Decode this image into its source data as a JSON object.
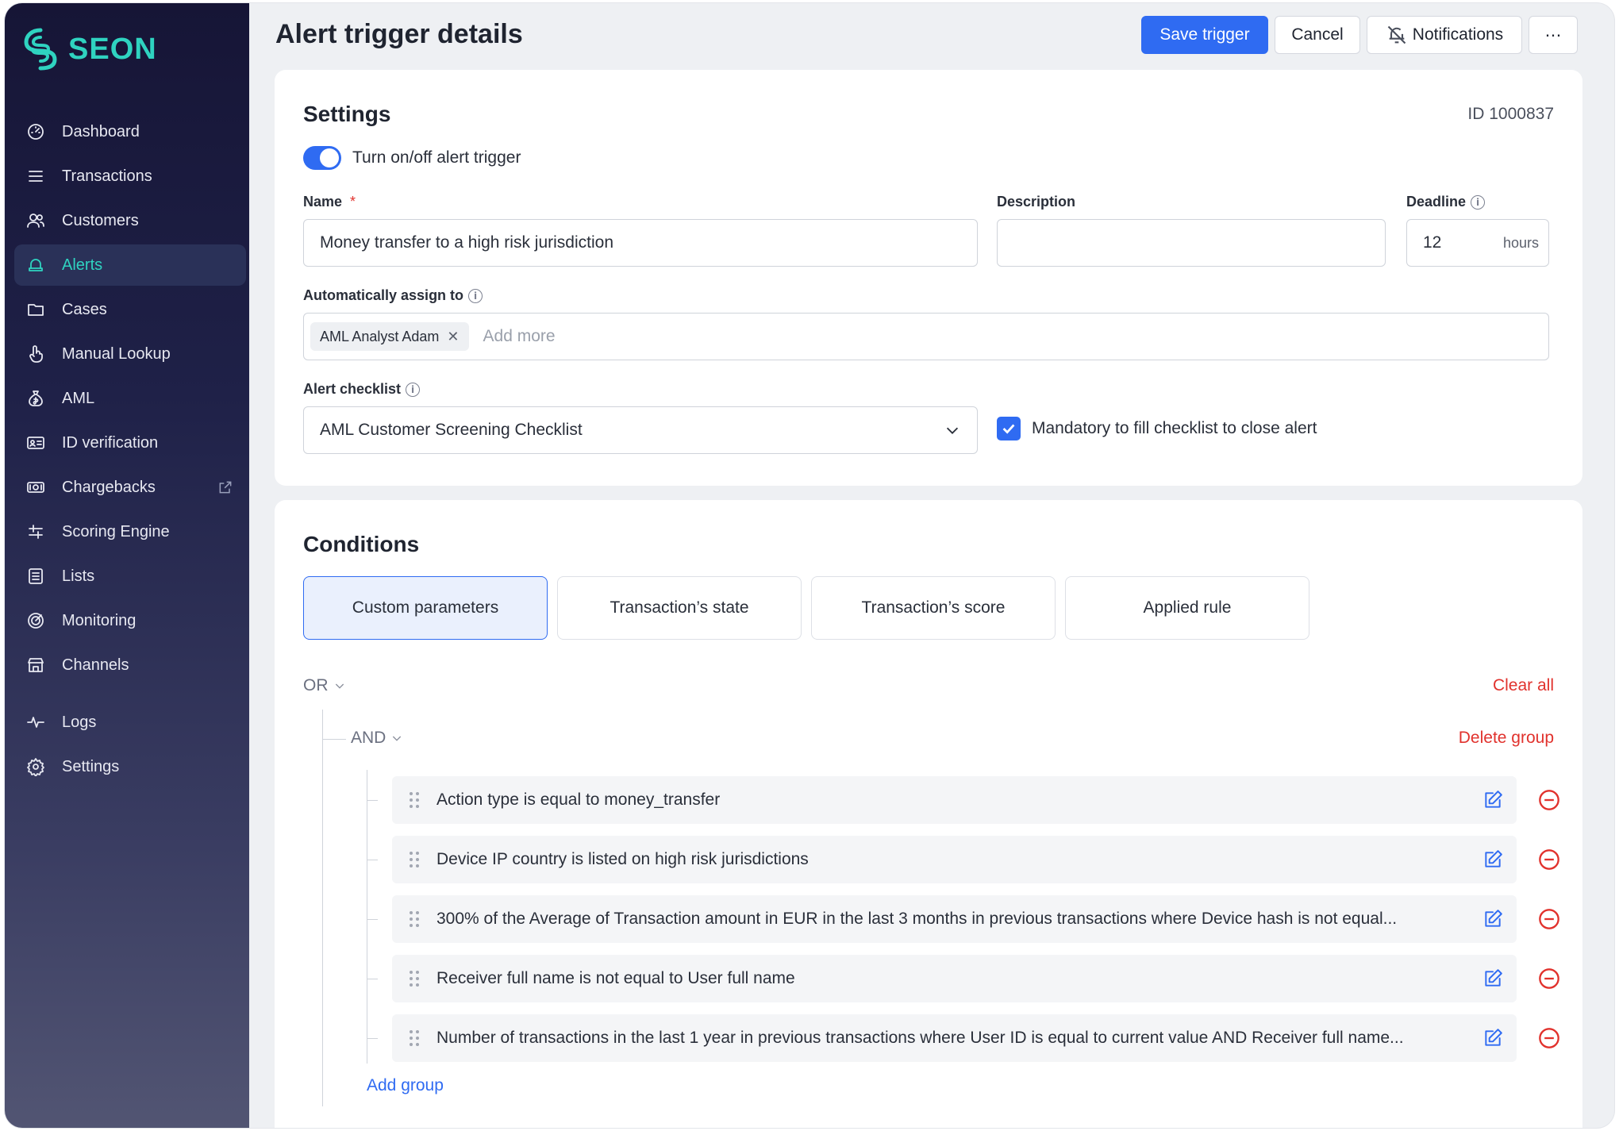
{
  "brand": {
    "name": "SEON",
    "accent": "#2fd3c0"
  },
  "sidebar": {
    "items": [
      {
        "label": "Dashboard",
        "icon": "dashboard-icon"
      },
      {
        "label": "Transactions",
        "icon": "list-icon"
      },
      {
        "label": "Customers",
        "icon": "users-icon"
      },
      {
        "label": "Alerts",
        "icon": "bell-icon",
        "active": true
      },
      {
        "label": "Cases",
        "icon": "folder-icon"
      },
      {
        "label": "Manual Lookup",
        "icon": "hand-pointer-icon"
      },
      {
        "label": "AML",
        "icon": "money-bag-icon"
      },
      {
        "label": "ID verification",
        "icon": "id-card-icon"
      },
      {
        "label": "Chargebacks",
        "icon": "cash-icon",
        "external": true
      },
      {
        "label": "Scoring Engine",
        "icon": "sliders-icon"
      },
      {
        "label": "Lists",
        "icon": "list-box-icon"
      },
      {
        "label": "Monitoring",
        "icon": "radar-icon"
      },
      {
        "label": "Channels",
        "icon": "store-icon"
      }
    ],
    "bottom_items": [
      {
        "label": "Logs",
        "icon": "pulse-icon"
      },
      {
        "label": "Settings",
        "icon": "gear-icon"
      }
    ]
  },
  "header": {
    "title": "Alert trigger details",
    "save_label": "Save trigger",
    "cancel_label": "Cancel",
    "notifications_label": "Notifications",
    "more_label": "⋯"
  },
  "settings": {
    "title": "Settings",
    "id_label": "ID 1000837",
    "toggle_label": "Turn on/off alert trigger",
    "toggle_on": true,
    "name_label": "Name",
    "name_required_mark": "*",
    "name_value": "Money transfer to a high risk jurisdiction",
    "description_label": "Description",
    "description_value": "",
    "deadline_label": "Deadline",
    "deadline_value": "12",
    "deadline_unit": "hours",
    "assign_label": "Automatically assign to",
    "assignee_chip": "AML Analyst Adam",
    "assign_placeholder": "Add more",
    "checklist_label": "Alert checklist",
    "checklist_value": "AML Customer Screening Checklist",
    "mandatory_label": "Mandatory to fill checklist to close alert",
    "mandatory_checked": true
  },
  "conditions": {
    "title": "Conditions",
    "tabs": [
      {
        "label": "Custom parameters",
        "active": true
      },
      {
        "label": "Transaction’s state"
      },
      {
        "label": "Transaction’s score"
      },
      {
        "label": "Applied rule"
      }
    ],
    "outer_operator": "OR",
    "clear_all_label": "Clear all",
    "group_operator": "AND",
    "delete_group_label": "Delete group",
    "rows": [
      "Action type is equal to money_transfer",
      "Device IP country is listed on high risk jurisdictions",
      "300% of the Average of Transaction amount in EUR in the last 3 months in previous transactions where Device hash is not equal...",
      "Receiver full name is not equal to User full name",
      "Number of transactions in the last 1 year in previous transactions where User ID is equal to current value AND Receiver full name..."
    ],
    "add_group_label": "Add group"
  }
}
